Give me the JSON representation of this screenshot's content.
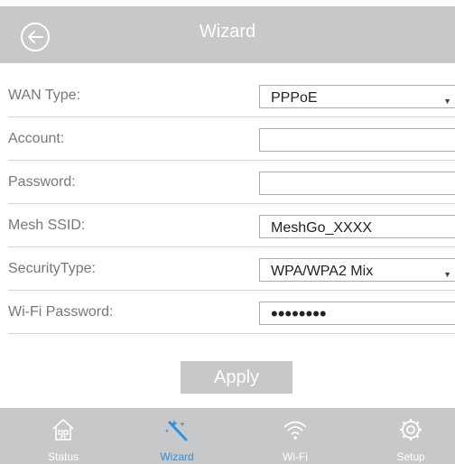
{
  "header": {
    "title": "Wizard",
    "back_icon": "back-arrow-circle-icon"
  },
  "form": {
    "wan_type": {
      "label": "WAN Type:",
      "value": "PPPoE"
    },
    "account": {
      "label": "Account:",
      "value": ""
    },
    "password": {
      "label": "Password:",
      "value": ""
    },
    "mesh_ssid": {
      "label": "Mesh SSID:",
      "value": "MeshGo_XXXX"
    },
    "security_type": {
      "label": "SecurityType:",
      "value": "WPA/WPA2 Mix"
    },
    "wifi_password": {
      "label": "Wi-Fi Password:",
      "value": "••••••••"
    }
  },
  "apply_label": "Apply",
  "nav": {
    "items": [
      {
        "label": "Status",
        "icon": "house-icon"
      },
      {
        "label": "Wizard",
        "icon": "magic-wand-icon",
        "active": true
      },
      {
        "label": "Wi-Fi",
        "icon": "wifi-icon"
      },
      {
        "label": "Setup",
        "icon": "gear-icon"
      }
    ]
  },
  "colors": {
    "bar": "#c7c8ca",
    "active": "#2f8fe0",
    "label": "#777777"
  }
}
